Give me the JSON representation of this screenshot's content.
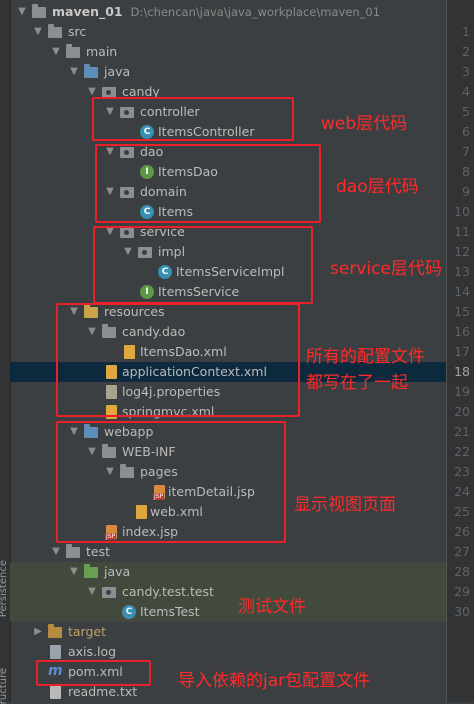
{
  "side_panel": {
    "labels": [
      "Persistence",
      "ructure"
    ]
  },
  "project": {
    "name": "maven_01",
    "path": "D:\\chencan\\java\\java_workplace\\maven_01"
  },
  "tree": {
    "src": "src",
    "main": "main",
    "java": "java",
    "candy": "candy",
    "controller": "controller",
    "items_controller": "ItemsController",
    "dao": "dao",
    "items_dao": "ItemsDao",
    "domain": "domain",
    "items": "Items",
    "service": "service",
    "impl": "impl",
    "items_service_impl": "ItemsServiceImpl",
    "items_service": "ItemsService",
    "resources": "resources",
    "candy_dao": "candy.dao",
    "items_dao_xml": "ItemsDao.xml",
    "application_context": "applicationContext.xml",
    "log4j": "log4j.properties",
    "springmvc": "springmvc.xml",
    "webapp": "webapp",
    "web_inf": "WEB-INF",
    "pages": "pages",
    "item_detail": "itemDetail.jsp",
    "web_xml": "web.xml",
    "index_jsp": "index.jsp",
    "test": "test",
    "test_java": "java",
    "candy_test_test": "candy.test.test",
    "items_test": "ItemsTest",
    "target": "target",
    "axis_log": "axis.log",
    "pom_xml": "pom.xml",
    "readme": "readme.txt"
  },
  "line_numbers": [
    "1",
    "2",
    "3",
    "4",
    "5",
    "6",
    "7",
    "8",
    "9",
    "10",
    "11",
    "12",
    "13",
    "14",
    "15",
    "16",
    "17",
    "18",
    "19",
    "20",
    "21",
    "22",
    "23",
    "24",
    "25",
    "26",
    "27",
    "28",
    "29",
    "30"
  ],
  "current_line": "18",
  "annotations": {
    "web": "web层代码",
    "dao": "dao层代码",
    "service": "service层代码",
    "config_line1": "所有的配置文件",
    "config_line2": "都写在了一起",
    "view": "显示视图页面",
    "test": "测试文件",
    "pom": "导入依赖的jar包配置文件"
  },
  "colors": {
    "annotation_red": "#e8212b",
    "panel_bg": "#3c3f41",
    "selection_blue": "#0d293e",
    "test_green": "#414a3d"
  }
}
